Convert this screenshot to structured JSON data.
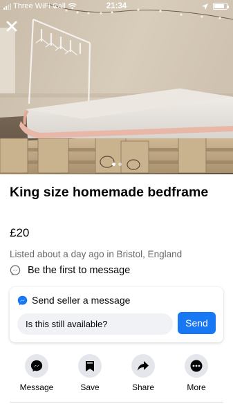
{
  "status_bar": {
    "carrier": "Three WiFi Call",
    "time": "21:34"
  },
  "photo": {
    "description_icon": "bedframe-photo",
    "carousel": {
      "count": 2,
      "active_index": 0
    }
  },
  "listing": {
    "title": "King size homemade bedframe",
    "price": "£20",
    "listed_text": "Listed about a day ago in Bristol, England",
    "first_message_text": "Be the first to message"
  },
  "message_card": {
    "heading": "Send seller a message",
    "input_value": "Is this still available?",
    "send_label": "Send"
  },
  "actions": [
    {
      "label": "Message",
      "icon": "messenger-icon"
    },
    {
      "label": "Save",
      "icon": "bookmark-icon"
    },
    {
      "label": "Share",
      "icon": "share-arrow-icon"
    },
    {
      "label": "More",
      "icon": "more-dots-icon"
    }
  ],
  "colors": {
    "accent": "#1877f2",
    "secondary_text": "#65676b",
    "button_bg": "#e4e6eb"
  }
}
